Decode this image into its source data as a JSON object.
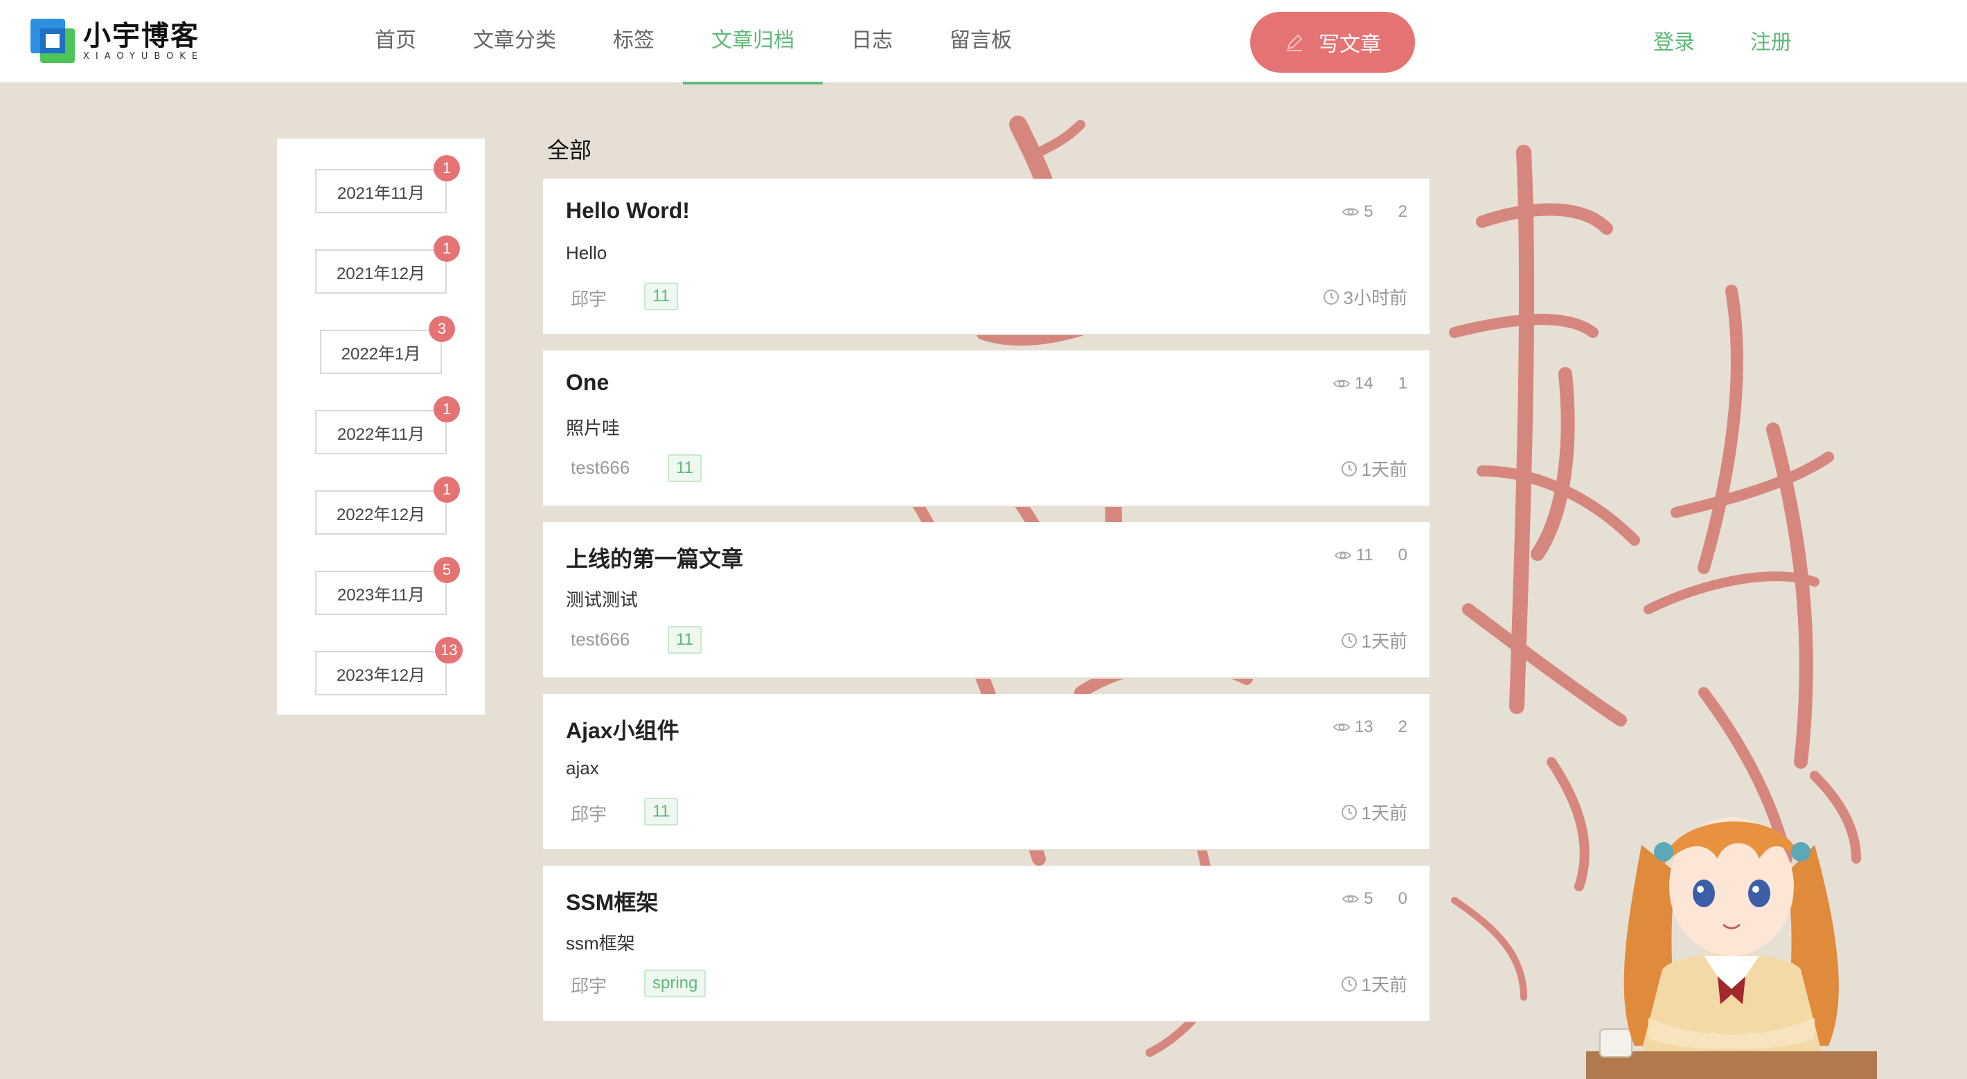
{
  "header": {
    "logo_title": "小宇博客",
    "logo_sub": "XIAOYUBOKE",
    "nav": [
      "首页",
      "文章分类",
      "标签",
      "文章归档",
      "日志",
      "留言板"
    ],
    "active_nav_index": 3,
    "write_button": "写文章",
    "login": "登录",
    "register": "注册"
  },
  "colors": {
    "accent_green": "#5fb878",
    "accent_red": "#e57373"
  },
  "archive": [
    {
      "label": "2021年11月",
      "count": "1"
    },
    {
      "label": "2021年12月",
      "count": "1"
    },
    {
      "label": "2022年1月",
      "count": "3"
    },
    {
      "label": "2022年11月",
      "count": "1"
    },
    {
      "label": "2022年12月",
      "count": "1"
    },
    {
      "label": "2023年11月",
      "count": "5"
    },
    {
      "label": "2023年12月",
      "count": "13"
    }
  ],
  "section_title": "全部",
  "articles": [
    {
      "title": "Hello Word!",
      "summary": "Hello",
      "author": "邱宇",
      "tag": "11",
      "views": "5",
      "comments": "2",
      "time": "3小时前"
    },
    {
      "title": "One",
      "summary": "照片哇",
      "author": "test666",
      "tag": "11",
      "views": "14",
      "comments": "1",
      "time": "1天前"
    },
    {
      "title": "上线的第一篇文章",
      "summary": "测试测试",
      "author": "test666",
      "tag": "11",
      "views": "11",
      "comments": "0",
      "time": "1天前"
    },
    {
      "title": "Ajax小组件",
      "summary": "ajax",
      "author": "邱宇",
      "tag": "11",
      "views": "13",
      "comments": "2",
      "time": "1天前"
    },
    {
      "title": "SSM框架",
      "summary": "ssm框架",
      "author": "邱宇",
      "tag": "spring",
      "views": "5",
      "comments": "0",
      "time": "1天前"
    }
  ]
}
